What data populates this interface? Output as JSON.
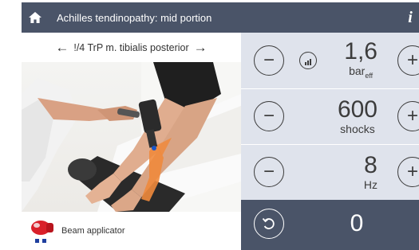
{
  "header": {
    "title": "Achilles tendinopathy: mid portion",
    "info_label": "i"
  },
  "nav": {
    "point_label": "!/4 TrP m. tibialis posterior"
  },
  "applicator": {
    "label": "Beam applicator"
  },
  "parameters": {
    "pressure": {
      "value": "1,6",
      "unit": "bar",
      "unit_sub": "eff"
    },
    "shocks": {
      "value": "600",
      "unit": "shocks"
    },
    "frequency": {
      "value": "8",
      "unit": "Hz"
    }
  },
  "counter": {
    "value": "0"
  },
  "icons": {
    "home": "home-icon",
    "prev": "arrow-left-icon",
    "next": "arrow-right-icon",
    "minus": "minus-icon",
    "plus": "plus-icon",
    "gauge": "gauge-icon",
    "reset": "reset-icon",
    "info": "info-icon"
  },
  "colors": {
    "header_bg": "#4a5468",
    "panel_bg": "#dfe3ec",
    "tape": "#f08a3c",
    "applicator_red": "#d9202a"
  }
}
